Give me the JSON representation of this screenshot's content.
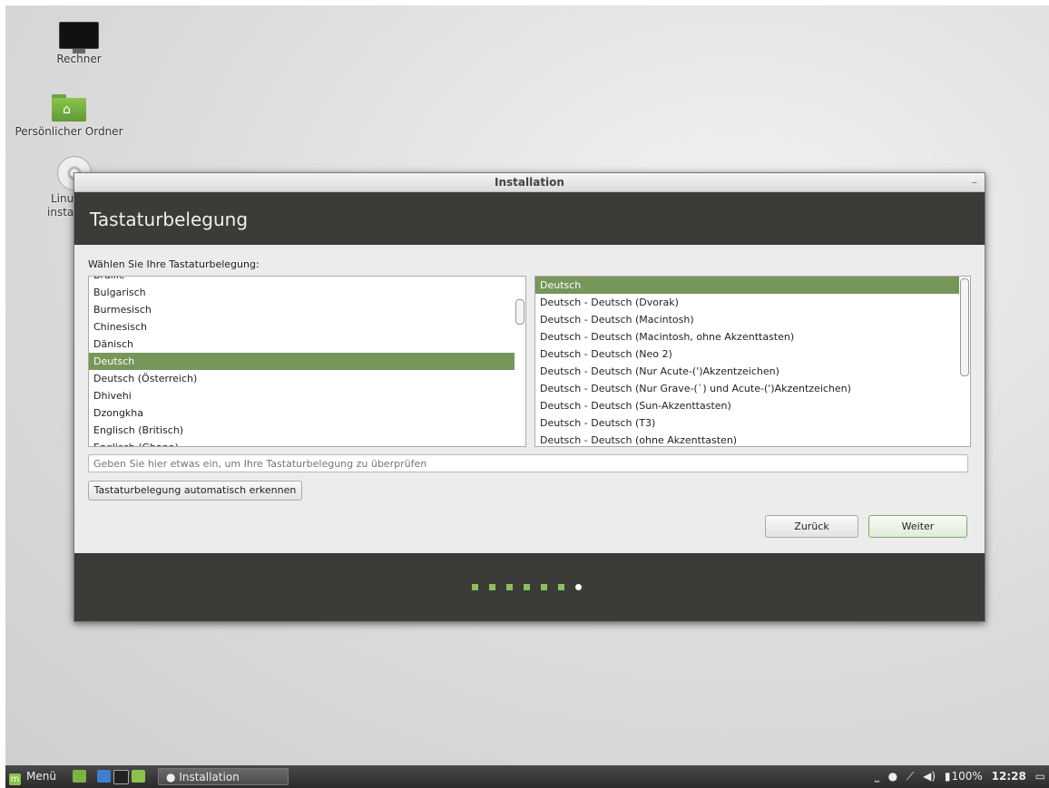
{
  "desktop": {
    "icons": [
      {
        "label": "Rechner",
        "icon": "computer-icon"
      },
      {
        "label": "Persönlicher Ordner",
        "icon": "home-folder-icon"
      },
      {
        "label": "Linu",
        "label2": "insta",
        "icon": "disc-icon"
      }
    ]
  },
  "window": {
    "title": "Installation",
    "minimize_glyph": "–",
    "heading": "Tastaturbelegung",
    "prompt": "Wählen Sie Ihre Tastaturbelegung:",
    "layouts": [
      "Braille",
      "Bulgarisch",
      "Burmesisch",
      "Chinesisch",
      "Dänisch",
      "Deutsch",
      "Deutsch (Österreich)",
      "Dhivehi",
      "Dzongkha",
      "Englisch (Britisch)",
      "Englisch (Ghana)"
    ],
    "selected_layout": "Deutsch",
    "variants": [
      "Deutsch",
      "Deutsch - Deutsch (Dvorak)",
      "Deutsch - Deutsch (Macintosh)",
      "Deutsch - Deutsch (Macintosh, ohne Akzenttasten)",
      "Deutsch - Deutsch (Neo 2)",
      "Deutsch - Deutsch (Nur Acute-(')Akzentzeichen)",
      "Deutsch - Deutsch (Nur Grave-(`) und Acute-(')Akzentzeichen)",
      "Deutsch - Deutsch (Sun-Akzenttasten)",
      "Deutsch - Deutsch (T3)",
      "Deutsch - Deutsch (ohne Akzenttasten)"
    ],
    "selected_variant": "Deutsch",
    "test_placeholder": "Geben Sie hier etwas ein, um Ihre Tastaturbelegung zu überprüfen",
    "detect_button": "Tastaturbelegung automatisch erkennen",
    "back_button": "Zurück",
    "next_button": "Weiter",
    "progress": {
      "total_steps": 7,
      "current_step": 7
    }
  },
  "taskbar": {
    "menu_label": "Menü",
    "task_label": "Installation",
    "battery": "100%",
    "time": "12:28"
  },
  "colors": {
    "accent": "#76965a",
    "header_bg": "#3c3b37",
    "progress_dot": "#8bbf5e"
  }
}
